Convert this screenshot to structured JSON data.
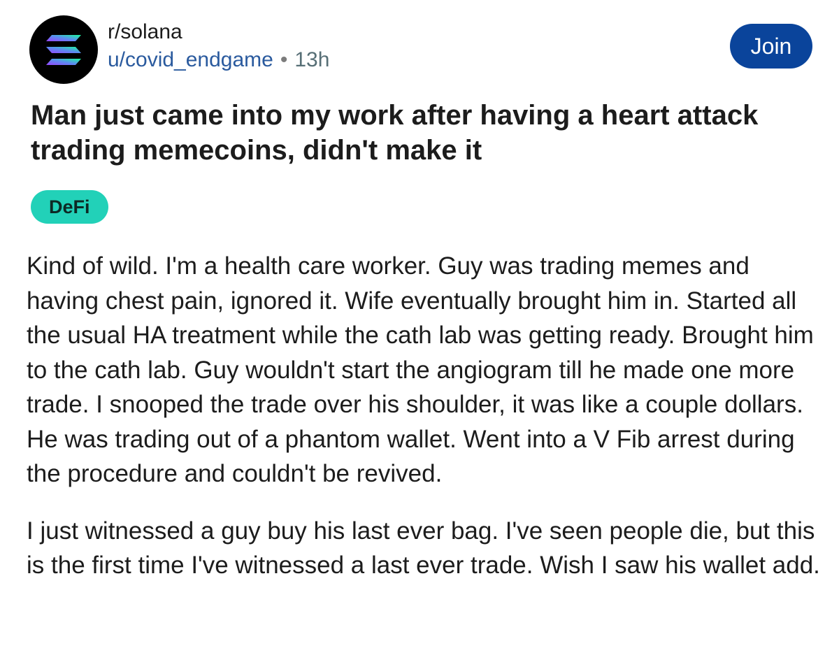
{
  "post": {
    "subreddit": "r/solana",
    "username": "u/covid_endgame",
    "separator": "•",
    "age": "13h",
    "join_label": "Join",
    "title": "Man just came into my work after having a heart attack trading memecoins, didn't make it",
    "flair": "DeFi",
    "flair_color": "#22d1b8",
    "join_color": "#0a449b",
    "avatar_icon": "solana-logo-icon",
    "body": [
      "Kind of wild. I'm a health care worker. Guy was trading memes and having chest pain, ignored it. Wife eventually brought him in. Started all the usual HA treatment while the cath lab was getting ready. Brought him to the cath lab. Guy wouldn't start the angiogram till he made one more trade. I snooped the trade over his shoulder, it was like a couple dollars. He was trading out of a phantom wallet. Went into a V Fib arrest during the procedure and couldn't be revived.",
      "I just witnessed a guy buy his last ever bag. I've seen people die, but this is the first time I've witnessed a last ever trade. Wish I saw his wallet add."
    ]
  }
}
